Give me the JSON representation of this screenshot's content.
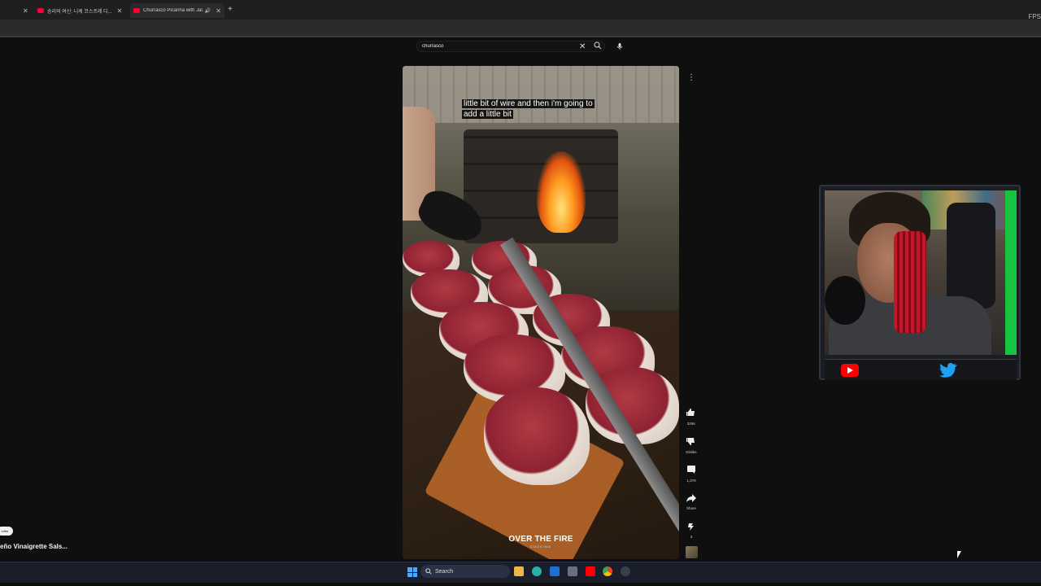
{
  "browser": {
    "tabs": [
      {
        "label": "",
        "closable": true
      },
      {
        "label": "승리의 여신: 니케 코스프레 디...",
        "closable": true
      },
      {
        "label": "Churrasco Picanha with Jal...",
        "closable": true,
        "active": true,
        "audio": true
      }
    ],
    "new_tab_label": "+",
    "fps_label": "FPS"
  },
  "youtube": {
    "search": {
      "value": "churrasco",
      "placeholder": "Search"
    },
    "video": {
      "caption_line1": "little bit of wire and then i'm going to",
      "caption_line2": "add a little bit",
      "watermark": "OVER THE FIRE",
      "watermark_sub": "COOKING"
    },
    "actions": {
      "like_count": "326K",
      "dislike_label": "Dislike",
      "comment_count": "1,379",
      "share_label": "Share",
      "remix_count": "3"
    },
    "left_panel": {
      "subscribe_chip": "cribe",
      "video_title": "eño Vinaigrette Sals..."
    }
  },
  "taskbar": {
    "search_label": "Search"
  },
  "colors": {
    "accent_red": "#ff0000",
    "twitter_blue": "#1da1f2",
    "screen_green": "#17c43f",
    "background": "#0f0f0f"
  },
  "icons": [
    "close-icon",
    "search-icon",
    "mic-icon",
    "more-vert-icon",
    "thumb-up-icon",
    "thumb-down-icon",
    "comment-icon",
    "share-icon",
    "remix-icon",
    "youtube-logo-icon",
    "twitter-logo-icon",
    "windows-start-icon"
  ]
}
